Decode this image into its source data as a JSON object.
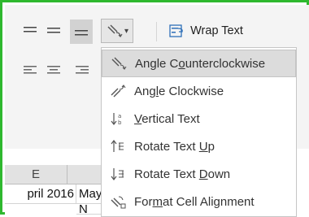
{
  "ribbon": {
    "wrap_text_label": "Wrap Text",
    "orientation_arrow": "▾"
  },
  "sheet": {
    "column_e": "E",
    "cells": {
      "april": "pril 2016",
      "may": "May",
      "n_char": "N"
    }
  },
  "menu": {
    "items": [
      {
        "pre": "Angle C",
        "key": "o",
        "post": "unterclockwise",
        "highlighted": true
      },
      {
        "pre": "Ang",
        "key": "l",
        "post": "e Clockwise"
      },
      {
        "pre": "",
        "key": "V",
        "post": "ertical Text"
      },
      {
        "pre": "Rotate Text ",
        "key": "U",
        "post": "p"
      },
      {
        "pre": "Rotate Text ",
        "key": "D",
        "post": "own"
      },
      {
        "pre": "For",
        "key": "m",
        "post": "at Cell Alignment"
      }
    ]
  },
  "colors": {
    "frame": "#2eb82e",
    "ribbon_bg": "#f4f4f4",
    "highlight": "#dcdcdc"
  },
  "icons": [
    "align-top-icon",
    "align-middle-icon",
    "align-bottom-icon",
    "orientation-icon",
    "wrap-text-icon",
    "align-left-icon",
    "align-center-icon",
    "align-right-icon",
    "angle-counterclockwise-icon",
    "angle-clockwise-icon",
    "vertical-text-icon",
    "rotate-text-up-icon",
    "rotate-text-down-icon",
    "format-cell-alignment-icon"
  ]
}
